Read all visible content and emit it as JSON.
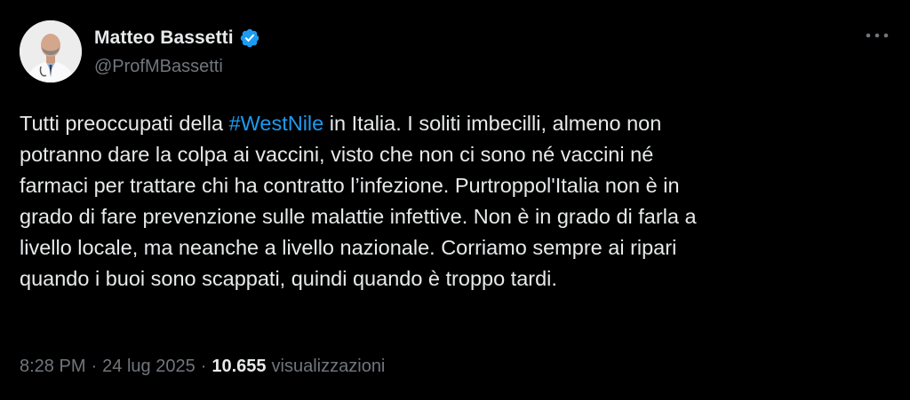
{
  "author": {
    "display_name": "Matteo Bassetti",
    "handle": "@ProfMBassetti",
    "verified_icon": "verified-badge-icon",
    "avatar_icon": "avatar-portrait"
  },
  "more_icon": "more-options-icon",
  "tweet": {
    "lines": [
      {
        "before": "Tutti preoccupati della ",
        "hashtag": "#WestNile",
        "after": " in Italia. I soliti imbecilli, almeno non"
      },
      {
        "text": "potranno dare la colpa ai vaccini, visto che non ci sono né vaccini né"
      },
      {
        "text": "farmaci per trattare chi ha contratto l’infezione. Purtroppol'Italia non è in"
      },
      {
        "text": "grado di fare prevenzione sulle malattie infettive. Non è in grado di farla a"
      },
      {
        "text": "livello locale, ma neanche a livello nazionale. Corriamo sempre ai ripari"
      },
      {
        "text": "quando i buoi sono scappati, quindi quando è troppo tardi."
      }
    ]
  },
  "meta": {
    "time": "8:28 PM",
    "separator": "·",
    "date": "24 lug 2025",
    "views_count": "10.655",
    "views_label": "visualizzazioni"
  },
  "colors": {
    "background": "#000000",
    "text": "#e7e9ea",
    "secondary": "#71767b",
    "accent": "#1d9bf0"
  }
}
